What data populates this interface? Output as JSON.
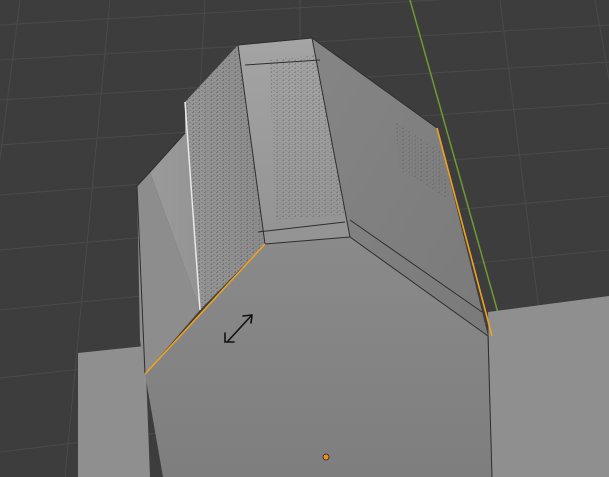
{
  "app": "3D Viewport",
  "viewport": {
    "background": "#3d3d3d",
    "grid_color": "#4a4a4a",
    "y_axis_color": "#6e9a33",
    "selected_edge_color": "#f0a21e",
    "origin_color": "#f08c1e"
  },
  "tool": {
    "cursor_icon": "scale-arrows-icon",
    "mode": "edge-select"
  }
}
